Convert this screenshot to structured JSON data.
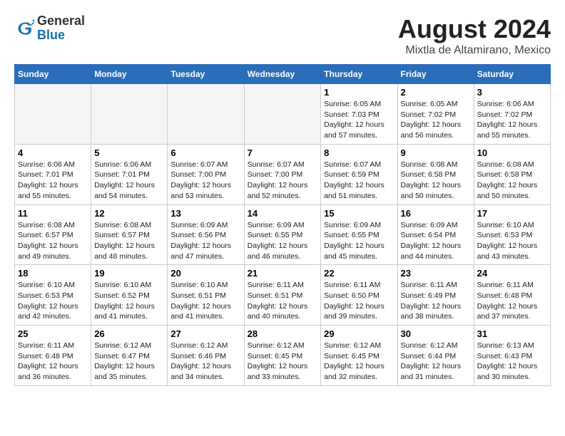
{
  "header": {
    "logo": {
      "general": "General",
      "blue": "Blue"
    },
    "month_year": "August 2024",
    "location": "Mixtla de Altamirano, Mexico"
  },
  "days_of_week": [
    "Sunday",
    "Monday",
    "Tuesday",
    "Wednesday",
    "Thursday",
    "Friday",
    "Saturday"
  ],
  "weeks": [
    [
      {
        "day": "",
        "empty": true
      },
      {
        "day": "",
        "empty": true
      },
      {
        "day": "",
        "empty": true
      },
      {
        "day": "",
        "empty": true
      },
      {
        "day": "1",
        "sunrise": "6:05 AM",
        "sunset": "7:03 PM",
        "daylight": "12 hours and 57 minutes."
      },
      {
        "day": "2",
        "sunrise": "6:05 AM",
        "sunset": "7:02 PM",
        "daylight": "12 hours and 56 minutes."
      },
      {
        "day": "3",
        "sunrise": "6:06 AM",
        "sunset": "7:02 PM",
        "daylight": "12 hours and 55 minutes."
      }
    ],
    [
      {
        "day": "4",
        "sunrise": "6:06 AM",
        "sunset": "7:01 PM",
        "daylight": "12 hours and 55 minutes."
      },
      {
        "day": "5",
        "sunrise": "6:06 AM",
        "sunset": "7:01 PM",
        "daylight": "12 hours and 54 minutes."
      },
      {
        "day": "6",
        "sunrise": "6:07 AM",
        "sunset": "7:00 PM",
        "daylight": "12 hours and 53 minutes."
      },
      {
        "day": "7",
        "sunrise": "6:07 AM",
        "sunset": "7:00 PM",
        "daylight": "12 hours and 52 minutes."
      },
      {
        "day": "8",
        "sunrise": "6:07 AM",
        "sunset": "6:59 PM",
        "daylight": "12 hours and 51 minutes."
      },
      {
        "day": "9",
        "sunrise": "6:08 AM",
        "sunset": "6:58 PM",
        "daylight": "12 hours and 50 minutes."
      },
      {
        "day": "10",
        "sunrise": "6:08 AM",
        "sunset": "6:58 PM",
        "daylight": "12 hours and 50 minutes."
      }
    ],
    [
      {
        "day": "11",
        "sunrise": "6:08 AM",
        "sunset": "6:57 PM",
        "daylight": "12 hours and 49 minutes."
      },
      {
        "day": "12",
        "sunrise": "6:08 AM",
        "sunset": "6:57 PM",
        "daylight": "12 hours and 48 minutes."
      },
      {
        "day": "13",
        "sunrise": "6:09 AM",
        "sunset": "6:56 PM",
        "daylight": "12 hours and 47 minutes."
      },
      {
        "day": "14",
        "sunrise": "6:09 AM",
        "sunset": "6:55 PM",
        "daylight": "12 hours and 46 minutes."
      },
      {
        "day": "15",
        "sunrise": "6:09 AM",
        "sunset": "6:55 PM",
        "daylight": "12 hours and 45 minutes."
      },
      {
        "day": "16",
        "sunrise": "6:09 AM",
        "sunset": "6:54 PM",
        "daylight": "12 hours and 44 minutes."
      },
      {
        "day": "17",
        "sunrise": "6:10 AM",
        "sunset": "6:53 PM",
        "daylight": "12 hours and 43 minutes."
      }
    ],
    [
      {
        "day": "18",
        "sunrise": "6:10 AM",
        "sunset": "6:53 PM",
        "daylight": "12 hours and 42 minutes."
      },
      {
        "day": "19",
        "sunrise": "6:10 AM",
        "sunset": "6:52 PM",
        "daylight": "12 hours and 41 minutes."
      },
      {
        "day": "20",
        "sunrise": "6:10 AM",
        "sunset": "6:51 PM",
        "daylight": "12 hours and 41 minutes."
      },
      {
        "day": "21",
        "sunrise": "6:11 AM",
        "sunset": "6:51 PM",
        "daylight": "12 hours and 40 minutes."
      },
      {
        "day": "22",
        "sunrise": "6:11 AM",
        "sunset": "6:50 PM",
        "daylight": "12 hours and 39 minutes."
      },
      {
        "day": "23",
        "sunrise": "6:11 AM",
        "sunset": "6:49 PM",
        "daylight": "12 hours and 38 minutes."
      },
      {
        "day": "24",
        "sunrise": "6:11 AM",
        "sunset": "6:48 PM",
        "daylight": "12 hours and 37 minutes."
      }
    ],
    [
      {
        "day": "25",
        "sunrise": "6:11 AM",
        "sunset": "6:48 PM",
        "daylight": "12 hours and 36 minutes."
      },
      {
        "day": "26",
        "sunrise": "6:12 AM",
        "sunset": "6:47 PM",
        "daylight": "12 hours and 35 minutes."
      },
      {
        "day": "27",
        "sunrise": "6:12 AM",
        "sunset": "6:46 PM",
        "daylight": "12 hours and 34 minutes."
      },
      {
        "day": "28",
        "sunrise": "6:12 AM",
        "sunset": "6:45 PM",
        "daylight": "12 hours and 33 minutes."
      },
      {
        "day": "29",
        "sunrise": "6:12 AM",
        "sunset": "6:45 PM",
        "daylight": "12 hours and 32 minutes."
      },
      {
        "day": "30",
        "sunrise": "6:12 AM",
        "sunset": "6:44 PM",
        "daylight": "12 hours and 31 minutes."
      },
      {
        "day": "31",
        "sunrise": "6:13 AM",
        "sunset": "6:43 PM",
        "daylight": "12 hours and 30 minutes."
      }
    ]
  ]
}
